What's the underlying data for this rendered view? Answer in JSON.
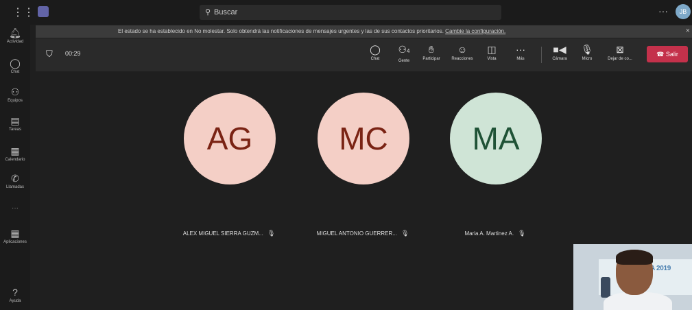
{
  "search": {
    "placeholder": "Buscar"
  },
  "topbar": {
    "more": "···",
    "avatar_initials": "JB"
  },
  "banner": {
    "message": "El estado se ha establecido en No molestar. Solo obtendrá las notificaciones de mensajes urgentes y las de sus contactos prioritarios.",
    "link": "Cambie la configuración.",
    "close": "×"
  },
  "rail": {
    "items": [
      {
        "label": "Actividad"
      },
      {
        "label": "Chat"
      },
      {
        "label": "Equipos"
      },
      {
        "label": "Tareas"
      },
      {
        "label": "Calendario"
      },
      {
        "label": "Llamadas"
      },
      {
        "label": "Aplicaciones"
      },
      {
        "label": "Ayuda"
      }
    ],
    "more": "···"
  },
  "meeting": {
    "timer": "00:29",
    "toolbar": {
      "chat": "Chat",
      "people": "Gente",
      "people_count": "4",
      "raise_hand": "Participar",
      "reactions": "Reacciones",
      "view": "Vista",
      "more": "Más",
      "camera": "Cámara",
      "mic": "Micro",
      "share": "Dejar de co...",
      "leave": "Salir"
    }
  },
  "participants": [
    {
      "initials": "AG",
      "name": "ALEX MIGUEL SIERRA GUZM...",
      "bg": "#f4cfc6",
      "fg": "#7a2314"
    },
    {
      "initials": "MC",
      "name": "MIGUEL ANTONIO GUERRER...",
      "bg": "#f4cfc6",
      "fg": "#7a2314"
    },
    {
      "initials": "MA",
      "name": "Maria A. Martinez A.",
      "bg": "#cfe4d6",
      "fg": "#1f5236"
    }
  ],
  "self_view": {
    "poster_text": "UR A 2019"
  },
  "colors": {
    "leave": "#c4314b",
    "brand": "#6264a7"
  }
}
